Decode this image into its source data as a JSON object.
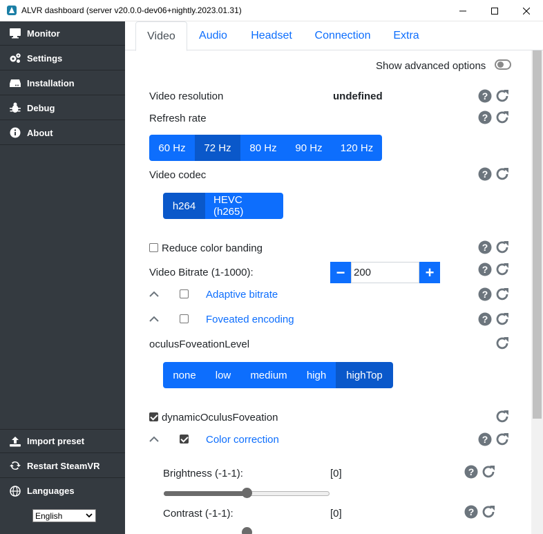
{
  "window": {
    "title": "ALVR dashboard (server v20.0.0-dev06+nightly.2023.01.31)"
  },
  "sidebar": {
    "items": [
      {
        "label": "Monitor",
        "icon": "monitor-icon"
      },
      {
        "label": "Settings",
        "icon": "gears-icon"
      },
      {
        "label": "Installation",
        "icon": "hdd-icon"
      },
      {
        "label": "Debug",
        "icon": "bug-icon"
      },
      {
        "label": "About",
        "icon": "info-icon"
      }
    ],
    "bottom_items": [
      {
        "label": "Import preset",
        "icon": "upload-icon"
      },
      {
        "label": "Restart SteamVR",
        "icon": "sync-icon"
      },
      {
        "label": "Languages",
        "icon": "globe-icon"
      }
    ],
    "language": {
      "selected": "English"
    }
  },
  "tabs": [
    "Video",
    "Audio",
    "Headset",
    "Connection",
    "Extra"
  ],
  "advanced": {
    "label": "Show advanced options",
    "enabled": false
  },
  "video": {
    "resolution": {
      "label": "Video resolution",
      "value": "undefined"
    },
    "refresh_rate": {
      "label": "Refresh rate",
      "options": [
        "60 Hz",
        "72 Hz",
        "80 Hz",
        "90 Hz",
        "120 Hz"
      ],
      "selected": "72 Hz"
    },
    "codec": {
      "label": "Video codec",
      "options": [
        "h264",
        "HEVC (h265)"
      ],
      "selected": "h264"
    },
    "reduce_color_banding": {
      "label": "Reduce color banding",
      "checked": false
    },
    "bitrate": {
      "label": "Video Bitrate (1-1000):",
      "value": "200",
      "minus": "−",
      "plus": "+"
    },
    "adaptive_bitrate": {
      "label": "Adaptive bitrate",
      "checked": false
    },
    "foveated_encoding": {
      "label": "Foveated encoding",
      "checked": false
    },
    "oculus_foveation_level": {
      "label": "oculusFoveationLevel",
      "options": [
        "none",
        "low",
        "medium",
        "high",
        "highTop"
      ],
      "selected": "highTop"
    },
    "dynamic_oculus_foveation": {
      "label": "dynamicOculusFoveation",
      "checked": true
    },
    "color_correction": {
      "label": "Color correction",
      "checked": true
    },
    "brightness": {
      "label": "Brightness (-1-1):",
      "value": "[0]",
      "level": 0
    },
    "contrast": {
      "label": "Contrast (-1-1):",
      "value": "[0]",
      "level": 0
    }
  }
}
